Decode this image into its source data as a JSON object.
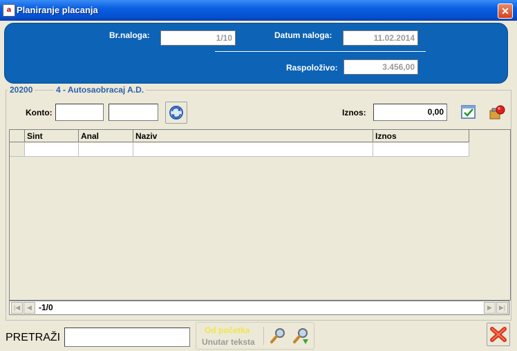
{
  "window": {
    "title": "Planiranje placanja",
    "app_icon_text": "a"
  },
  "header": {
    "br_naloga_label": "Br.naloga:",
    "br_naloga_value": "1/10",
    "datum_label": "Datum naloga:",
    "datum_value": "11.02.2014",
    "raspolozivo_label": "Raspoloživo:",
    "raspolozivo_value": "3.456,00"
  },
  "account": {
    "code": "20200",
    "name": "4 - Autosaobracaj A.D."
  },
  "form": {
    "konto_label": "Konto:",
    "konto_value_1": "",
    "konto_value_2": "",
    "iznos_label": "Iznos:",
    "iznos_value": "0,00"
  },
  "grid": {
    "columns": [
      "Sint",
      "Anal",
      "Naziv",
      "Iznos"
    ],
    "rows": [
      [
        "",
        "",
        "",
        ""
      ]
    ]
  },
  "navigator": {
    "position": "-1/0"
  },
  "search": {
    "label": "PRETRAŽI",
    "value": "",
    "mode_start": "Od početka",
    "mode_contains": "Unutar teksta"
  },
  "colors": {
    "header_bg": "#0d63b5",
    "title_bg": "#0650d4",
    "form_bg": "#ece9d8",
    "accent_text": "#2a5fb0"
  }
}
